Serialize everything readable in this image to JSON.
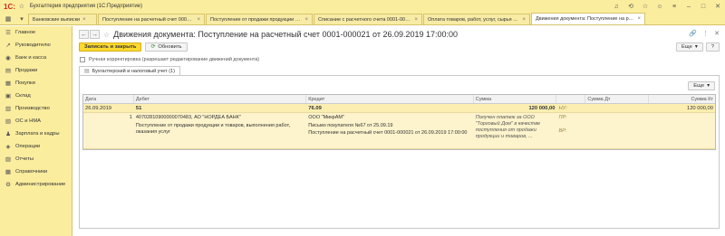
{
  "window": {
    "logo": "1С:",
    "title": "Бухгалтерия предприятия  (1С:Предприятие)"
  },
  "tabs": [
    {
      "label": "Банковские выписки"
    },
    {
      "label": "Поступление на расчетный счет 0001-000021"
    },
    {
      "label": "Поступление от продажи продукции и товар..."
    },
    {
      "label": "Списание с расчетного счета 0001-000030 о..."
    },
    {
      "label": "Оплата товаров, работ, услуг, сырья и иных ..."
    },
    {
      "label": "Движения документа: Поступление на расчет..."
    }
  ],
  "sidebar": {
    "items": [
      {
        "label": "Главное",
        "icon": "☰"
      },
      {
        "label": "Руководителю",
        "icon": "↗"
      },
      {
        "label": "Банк и касса",
        "icon": "◉"
      },
      {
        "label": "Продажи",
        "icon": "▤"
      },
      {
        "label": "Покупки",
        "icon": "▦"
      },
      {
        "label": "Склад",
        "icon": "▣"
      },
      {
        "label": "Производство",
        "icon": "▥"
      },
      {
        "label": "ОС и НМА",
        "icon": "▧"
      },
      {
        "label": "Зарплата и кадры",
        "icon": "♟"
      },
      {
        "label": "Операции",
        "icon": "◈"
      },
      {
        "label": "Отчеты",
        "icon": "▨"
      },
      {
        "label": "Справочники",
        "icon": "▩"
      },
      {
        "label": "Администрирование",
        "icon": "⚙"
      }
    ]
  },
  "doc": {
    "title": "Движения документа: Поступление на расчетный счет 0001-000021 от 26.09.2019 17:00:00",
    "save_close": "Записать и закрыть",
    "refresh": "Обновить",
    "more": "Еще",
    "help": "?",
    "manual_label": "Ручная корректировка (разрешает редактирование движений документа)",
    "subtab": "Бухгалтерский и налоговый учет (1)",
    "grid_more": "Еще"
  },
  "grid": {
    "headers": {
      "date": "Дата",
      "debit": "Дебет",
      "credit": "Кредит",
      "sum": "Сумма",
      "sumdt": "Сумма Дт",
      "sumkt": "Сумма Кт"
    },
    "row1": {
      "date": "26.09.2019",
      "debit": "51",
      "credit": "76.09",
      "sum": "120 000,00",
      "kind": "НУ:",
      "sumkt": "120 000,00"
    },
    "row2": {
      "num": "1",
      "debit_acc": "40702810900000070483, АО \"НОРДЕА БАНК\"",
      "debit_desc": "Поступление от продажи продукции и товаров, выполнения работ, оказания услуг",
      "credit_org": "ООО \"МикрАМ\"",
      "credit_letter": "Письмо покупателя №67 от 25.09.19",
      "credit_doc": "Поступление на расчетный счет 0001-000021 от 26.09.2019 17:00:00",
      "content": "Получен платеж за ООО \"Торговый Дом\" в качестве поступления от продажи продукции и товаров, ...",
      "kind_pr": "ПР:",
      "kind_vr": "ВР:"
    }
  },
  "colors": {
    "yellow": "#fbed9e",
    "accent": "#ffd92f",
    "row_selected": "#fbeeb0"
  }
}
